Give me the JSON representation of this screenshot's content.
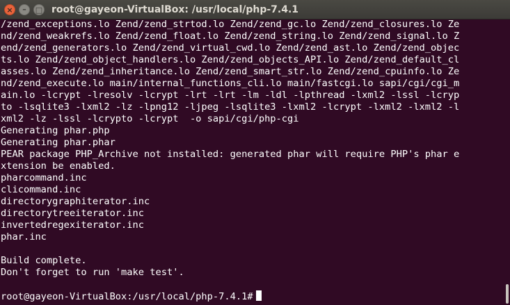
{
  "window": {
    "title": "root@gayeon-VirtualBox: /usr/local/php-7.4.1",
    "buttons": {
      "close": "×",
      "minimize": "–",
      "maximize": "□"
    }
  },
  "terminal": {
    "lines": [
      "/zend_exceptions.lo Zend/zend_strtod.lo Zend/zend_gc.lo Zend/zend_closures.lo Ze",
      "nd/zend_weakrefs.lo Zend/zend_float.lo Zend/zend_string.lo Zend/zend_signal.lo Z",
      "end/zend_generators.lo Zend/zend_virtual_cwd.lo Zend/zend_ast.lo Zend/zend_objec",
      "ts.lo Zend/zend_object_handlers.lo Zend/zend_objects_API.lo Zend/zend_default_cl",
      "asses.lo Zend/zend_inheritance.lo Zend/zend_smart_str.lo Zend/zend_cpuinfo.lo Ze",
      "nd/zend_execute.lo main/internal_functions_cli.lo main/fastcgi.lo sapi/cgi/cgi_m",
      "ain.lo -lcrypt -lresolv -lcrypt -lrt -lrt -lm -ldl -lpthread -lxml2 -lssl -lcryp",
      "to -lsqlite3 -lxml2 -lz -lpng12 -ljpeg -lsqlite3 -lxml2 -lcrypt -lxml2 -lxml2 -l",
      "xml2 -lz -lssl -lcrypto -lcrypt  -o sapi/cgi/php-cgi",
      "Generating phar.php",
      "Generating phar.phar",
      "PEAR package PHP_Archive not installed: generated phar will require PHP's phar e",
      "xtension be enabled.",
      "pharcommand.inc",
      "clicommand.inc",
      "directorygraphiterator.inc",
      "directorytreeiterator.inc",
      "invertedregexiterator.inc",
      "phar.inc",
      "",
      "Build complete.",
      "Don't forget to run 'make test'.",
      ""
    ],
    "prompt": "root@gayeon-VirtualBox:/usr/local/php-7.4.1#"
  }
}
